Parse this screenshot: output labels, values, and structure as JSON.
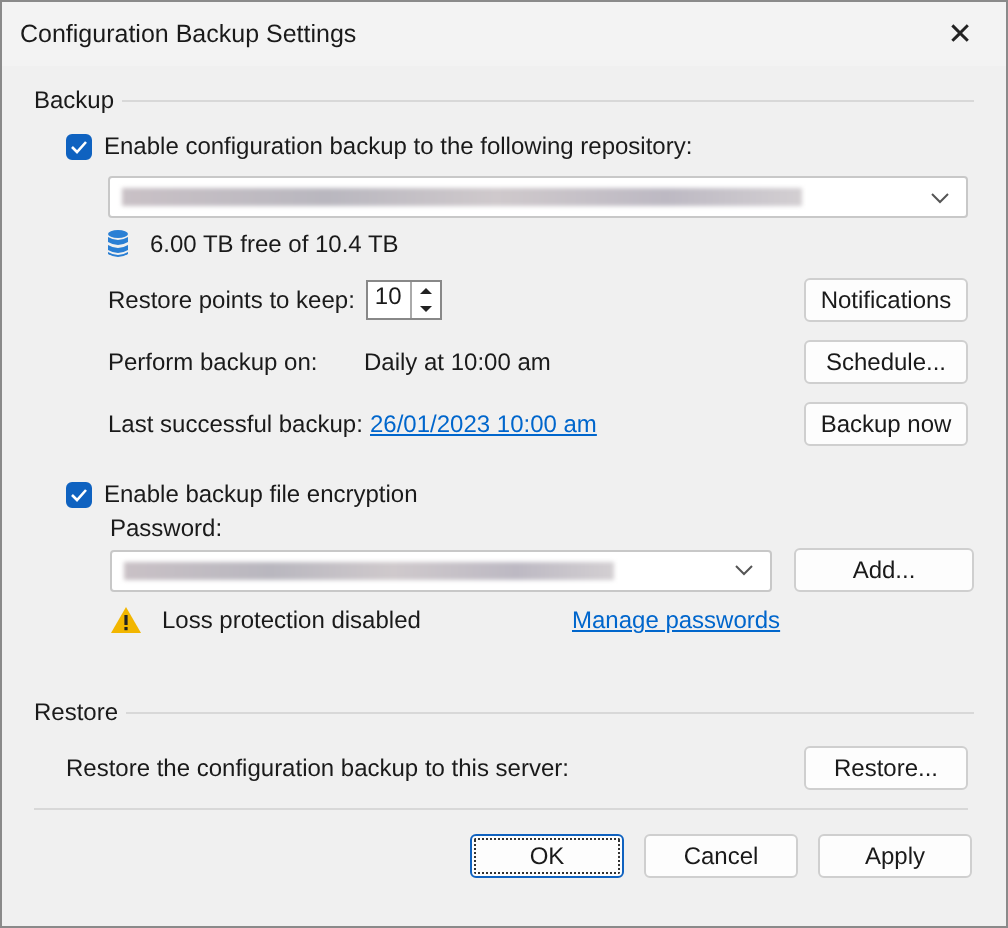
{
  "window": {
    "title": "Configuration Backup Settings",
    "close": "✕"
  },
  "backup": {
    "legend": "Backup",
    "enable": {
      "label": "Enable configuration backup to the following repository:",
      "checked": true
    },
    "repository": {
      "redacted": true
    },
    "storage": "6.00 TB free of 10.4 TB",
    "restore_points": {
      "label": "Restore points to keep:",
      "value": "10"
    },
    "notifications_button": "Notifications",
    "perform": {
      "label": "Perform backup on:",
      "value": "Daily at 10:00 am"
    },
    "schedule_button": "Schedule...",
    "last": {
      "label": "Last successful backup:",
      "link": "26/01/2023 10:00 am"
    },
    "backup_now_button": "Backup now",
    "encryption": {
      "label": "Enable backup file encryption",
      "checked": true
    },
    "password": {
      "label": "Password:",
      "redacted": true
    },
    "add_button": "Add...",
    "warning": "Loss protection disabled",
    "manage_link": "Manage passwords"
  },
  "restore": {
    "legend": "Restore",
    "label": "Restore the configuration backup to this server:",
    "button": "Restore..."
  },
  "buttons": [
    {
      "label": "OK",
      "focused": true
    },
    {
      "label": "Cancel",
      "focused": false
    },
    {
      "label": "Apply",
      "focused": false
    }
  ]
}
